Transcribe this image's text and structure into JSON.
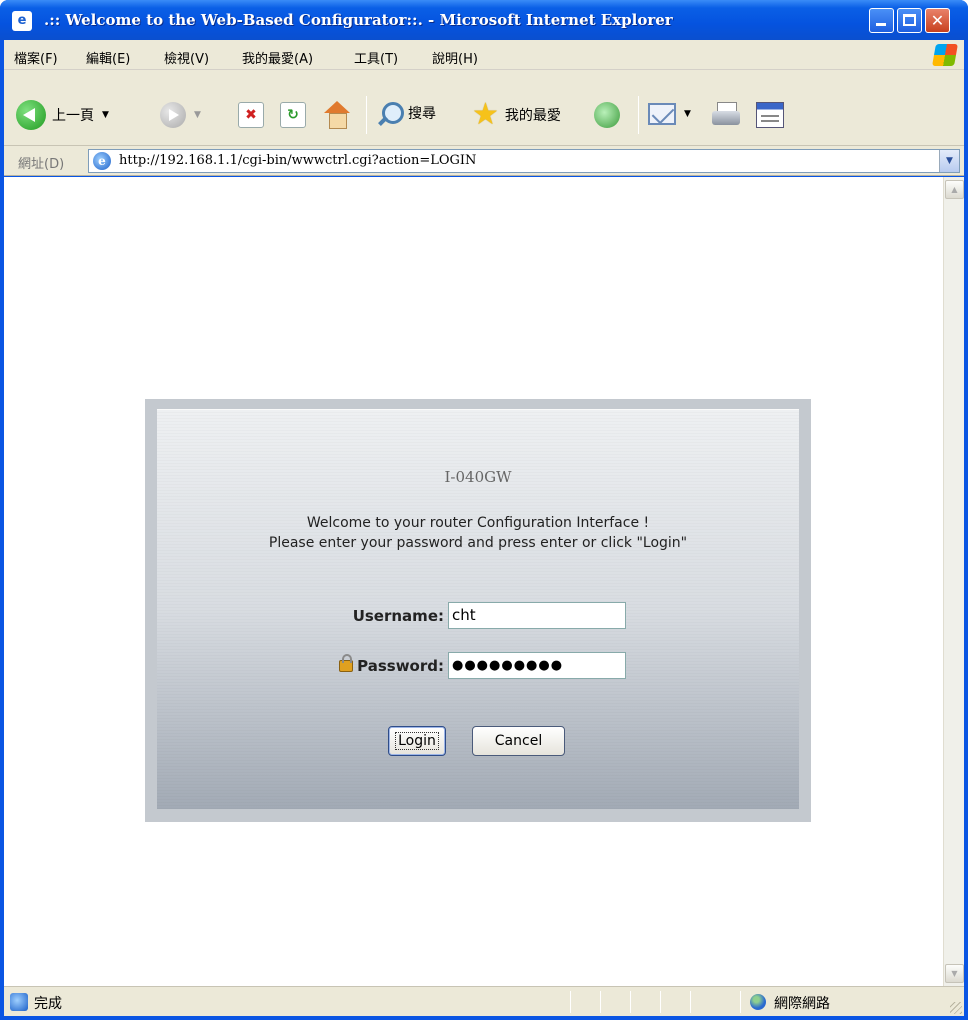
{
  "window": {
    "title": ".:: Welcome to the Web-Based Configurator::. - Microsoft Internet Explorer",
    "minimize_label": "",
    "close_label": "✕"
  },
  "menubar": {
    "items": [
      {
        "label": "檔案(F)"
      },
      {
        "label": "編輯(E)"
      },
      {
        "label": "檢視(V)"
      },
      {
        "label": "我的最愛(A)"
      },
      {
        "label": "工具(T)"
      },
      {
        "label": "說明(H)"
      }
    ]
  },
  "toolbar": {
    "back_label": "上一頁",
    "search_label": "搜尋",
    "favorites_label": "我的最愛",
    "icons": [
      "back-icon",
      "forward-icon",
      "stop-icon",
      "refresh-icon",
      "home-icon",
      "search-icon",
      "star-icon",
      "history-icon",
      "mail-icon",
      "print-icon",
      "edit-icon"
    ]
  },
  "addressbar": {
    "label": "網址(D)",
    "url": "http://192.168.1.1/cgi-bin/wwwctrl.cgi?action=LOGIN"
  },
  "login": {
    "model": "I-040GW",
    "welcome_line1": "Welcome to your router Configuration Interface !",
    "welcome_line2": "Please enter your password and press enter or click \"Login\"",
    "username_label": "Username:",
    "username_value": "cht",
    "password_label": "Password:",
    "password_value": "●●●●●●●●●",
    "login_button": "Login",
    "cancel_button": "Cancel"
  },
  "statusbar": {
    "status_text": "完成",
    "zone_text": "網際網路"
  },
  "colors": {
    "titlebar": "#0553df",
    "chrome": "#ece9d8",
    "login_frame": "#c4c9cf"
  }
}
